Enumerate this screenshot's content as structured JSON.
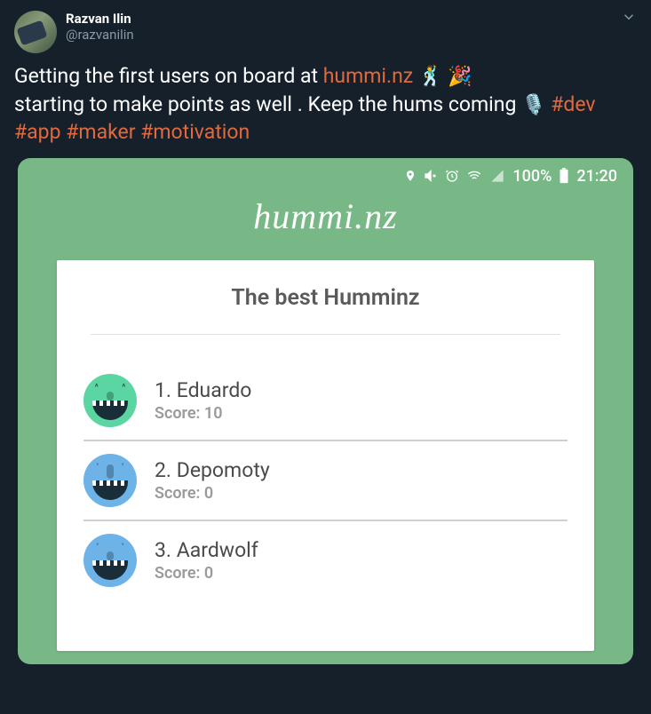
{
  "tweet": {
    "author": {
      "name": "Razvan Ilin",
      "handle": "@razvanilin"
    },
    "body": {
      "text1": "Getting the first users on board at ",
      "link": "hummi.nz",
      "emoji1": "🕺",
      "emoji2": "🎉",
      "text2": " starting to make points as well . Keep the hums coming ",
      "emoji3": "🎙️",
      "hashtags": [
        "#dev",
        "#app",
        "#maker",
        "#motivation"
      ]
    }
  },
  "embedded": {
    "statusbar": {
      "battery_pct": "100%",
      "time": "21:20"
    },
    "app_title": "hummi.nz",
    "card_title": "The best Humminz",
    "leaderboard": [
      {
        "rank": "1.",
        "name": "Eduardo",
        "score": "Score: 10",
        "color": "avatar-green"
      },
      {
        "rank": "2.",
        "name": "Depomoty",
        "score": "Score: 0",
        "color": "avatar-blue"
      },
      {
        "rank": "3.",
        "name": "Aardwolf",
        "score": "Score: 0",
        "color": "avatar-blue"
      }
    ]
  }
}
